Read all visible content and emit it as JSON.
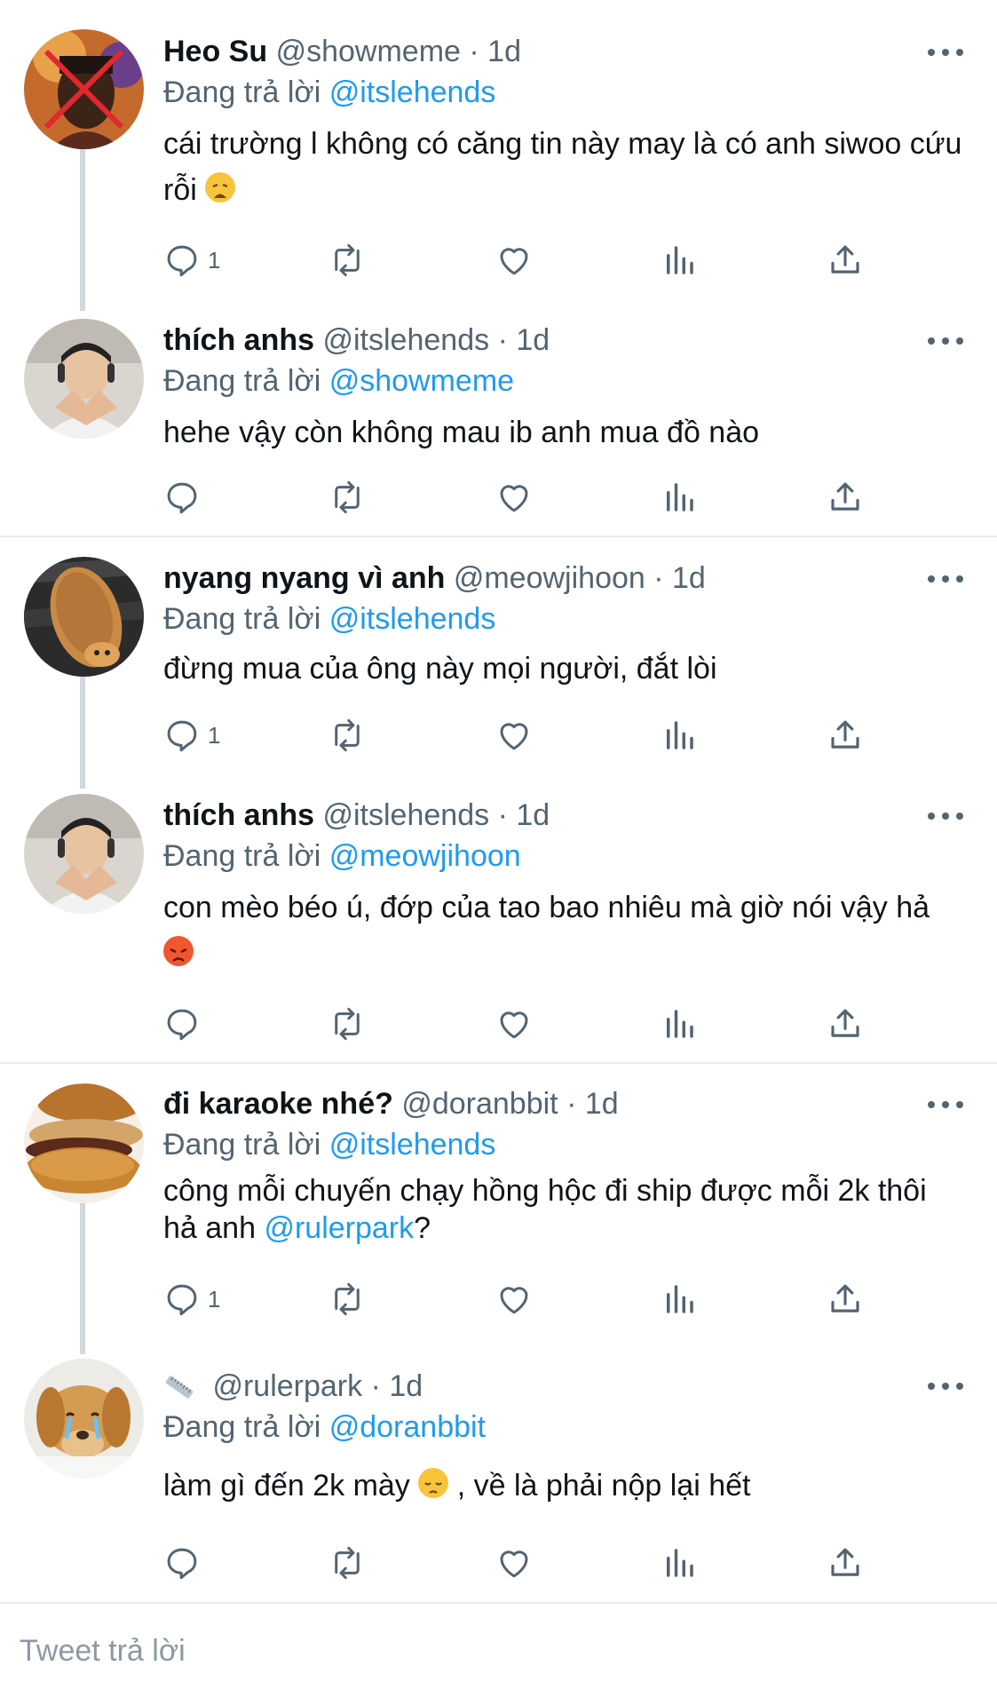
{
  "replying_label": "Đang trả lời",
  "tweets": [
    {
      "name": "Heo Su",
      "handle": "@showmeme",
      "time": "· 1d",
      "reply_to": "@itslehends",
      "text": "cái trường l không có căng tin này may là có anh siwoo cứu rỗi",
      "emoji": "weary-face",
      "reply_count": "1"
    },
    {
      "name": "thích anhs",
      "handle": "@itslehends",
      "time": "· 1d",
      "reply_to": "@showmeme",
      "text": "hehe vậy còn không mau ib anh mua đồ nào",
      "reply_count": ""
    },
    {
      "name": "nyang nyang vì anh",
      "handle": "@meowjihoon",
      "time": "· 1d",
      "reply_to": "@itslehends",
      "text": "đừng mua của ông này mọi người, đắt lòi",
      "reply_count": "1"
    },
    {
      "name": "thích anhs",
      "handle": "@itslehends",
      "time": "· 1d",
      "reply_to": "@meowjihoon",
      "text": "con mèo béo ú, đớp của tao bao nhiêu mà giờ nói vậy hả",
      "emoji": "angry-face",
      "reply_count": ""
    },
    {
      "name": "đi karaoke nhé?",
      "handle": "@doranbbit",
      "time": "· 1d",
      "reply_to": "@itslehends",
      "text_before": "công mỗi chuyến chạy hồng hộc đi ship được mỗi 2k thôi hả anh ",
      "text_mention": "@rulerpark",
      "text_after": "?",
      "reply_count": "1"
    },
    {
      "name": "",
      "name_icon": "ruler-icon",
      "handle": "@rulerpark",
      "time": "· 1d",
      "reply_to": "@doranbbit",
      "text_before": "làm gì đến 2k mày ",
      "emoji": "pensive-face",
      "text_after": " , về là phải nộp lại hết",
      "reply_count": ""
    }
  ],
  "reply_box": {
    "placeholder": "Tweet trả lời"
  },
  "colors": {
    "accent": "#1d9bf0",
    "muted": "#536471",
    "text": "#0f1419",
    "divider": "#e6ecf0",
    "thread_line": "#cfd9de"
  }
}
